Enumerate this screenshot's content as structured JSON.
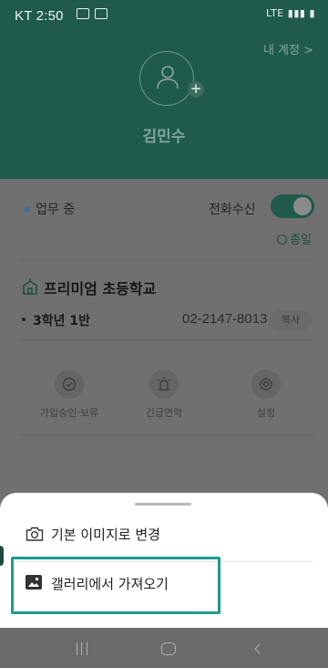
{
  "status_bar": {
    "time": "KT 2:50",
    "right_indicators": "LTE"
  },
  "header": {
    "my_account": "내 계정 >",
    "user_name": "김민수"
  },
  "work": {
    "status": "업무 중",
    "call_label": "전화수신",
    "call_enabled": true,
    "all_day": "종일"
  },
  "school": {
    "name": "프리미엄 초등학교",
    "class": "3학년 1반",
    "phone": "02-2147-8013",
    "copy_label": "복사"
  },
  "menu": {
    "items": [
      {
        "label": "가입승인·보류",
        "icon": "check-circle-icon"
      },
      {
        "label": "긴급연락",
        "icon": "alert-siren-icon"
      },
      {
        "label": "설정",
        "icon": "gear-icon"
      }
    ]
  },
  "sheet": {
    "items": [
      {
        "label": "기본 이미지로 변경",
        "icon": "camera-icon"
      },
      {
        "label": "갤러리에서 가져오기",
        "icon": "gallery-icon"
      }
    ]
  },
  "colors": {
    "hero": "#1f5a4c",
    "highlight": "#1f9b8c",
    "accent_dot": "#4b6c9a"
  }
}
